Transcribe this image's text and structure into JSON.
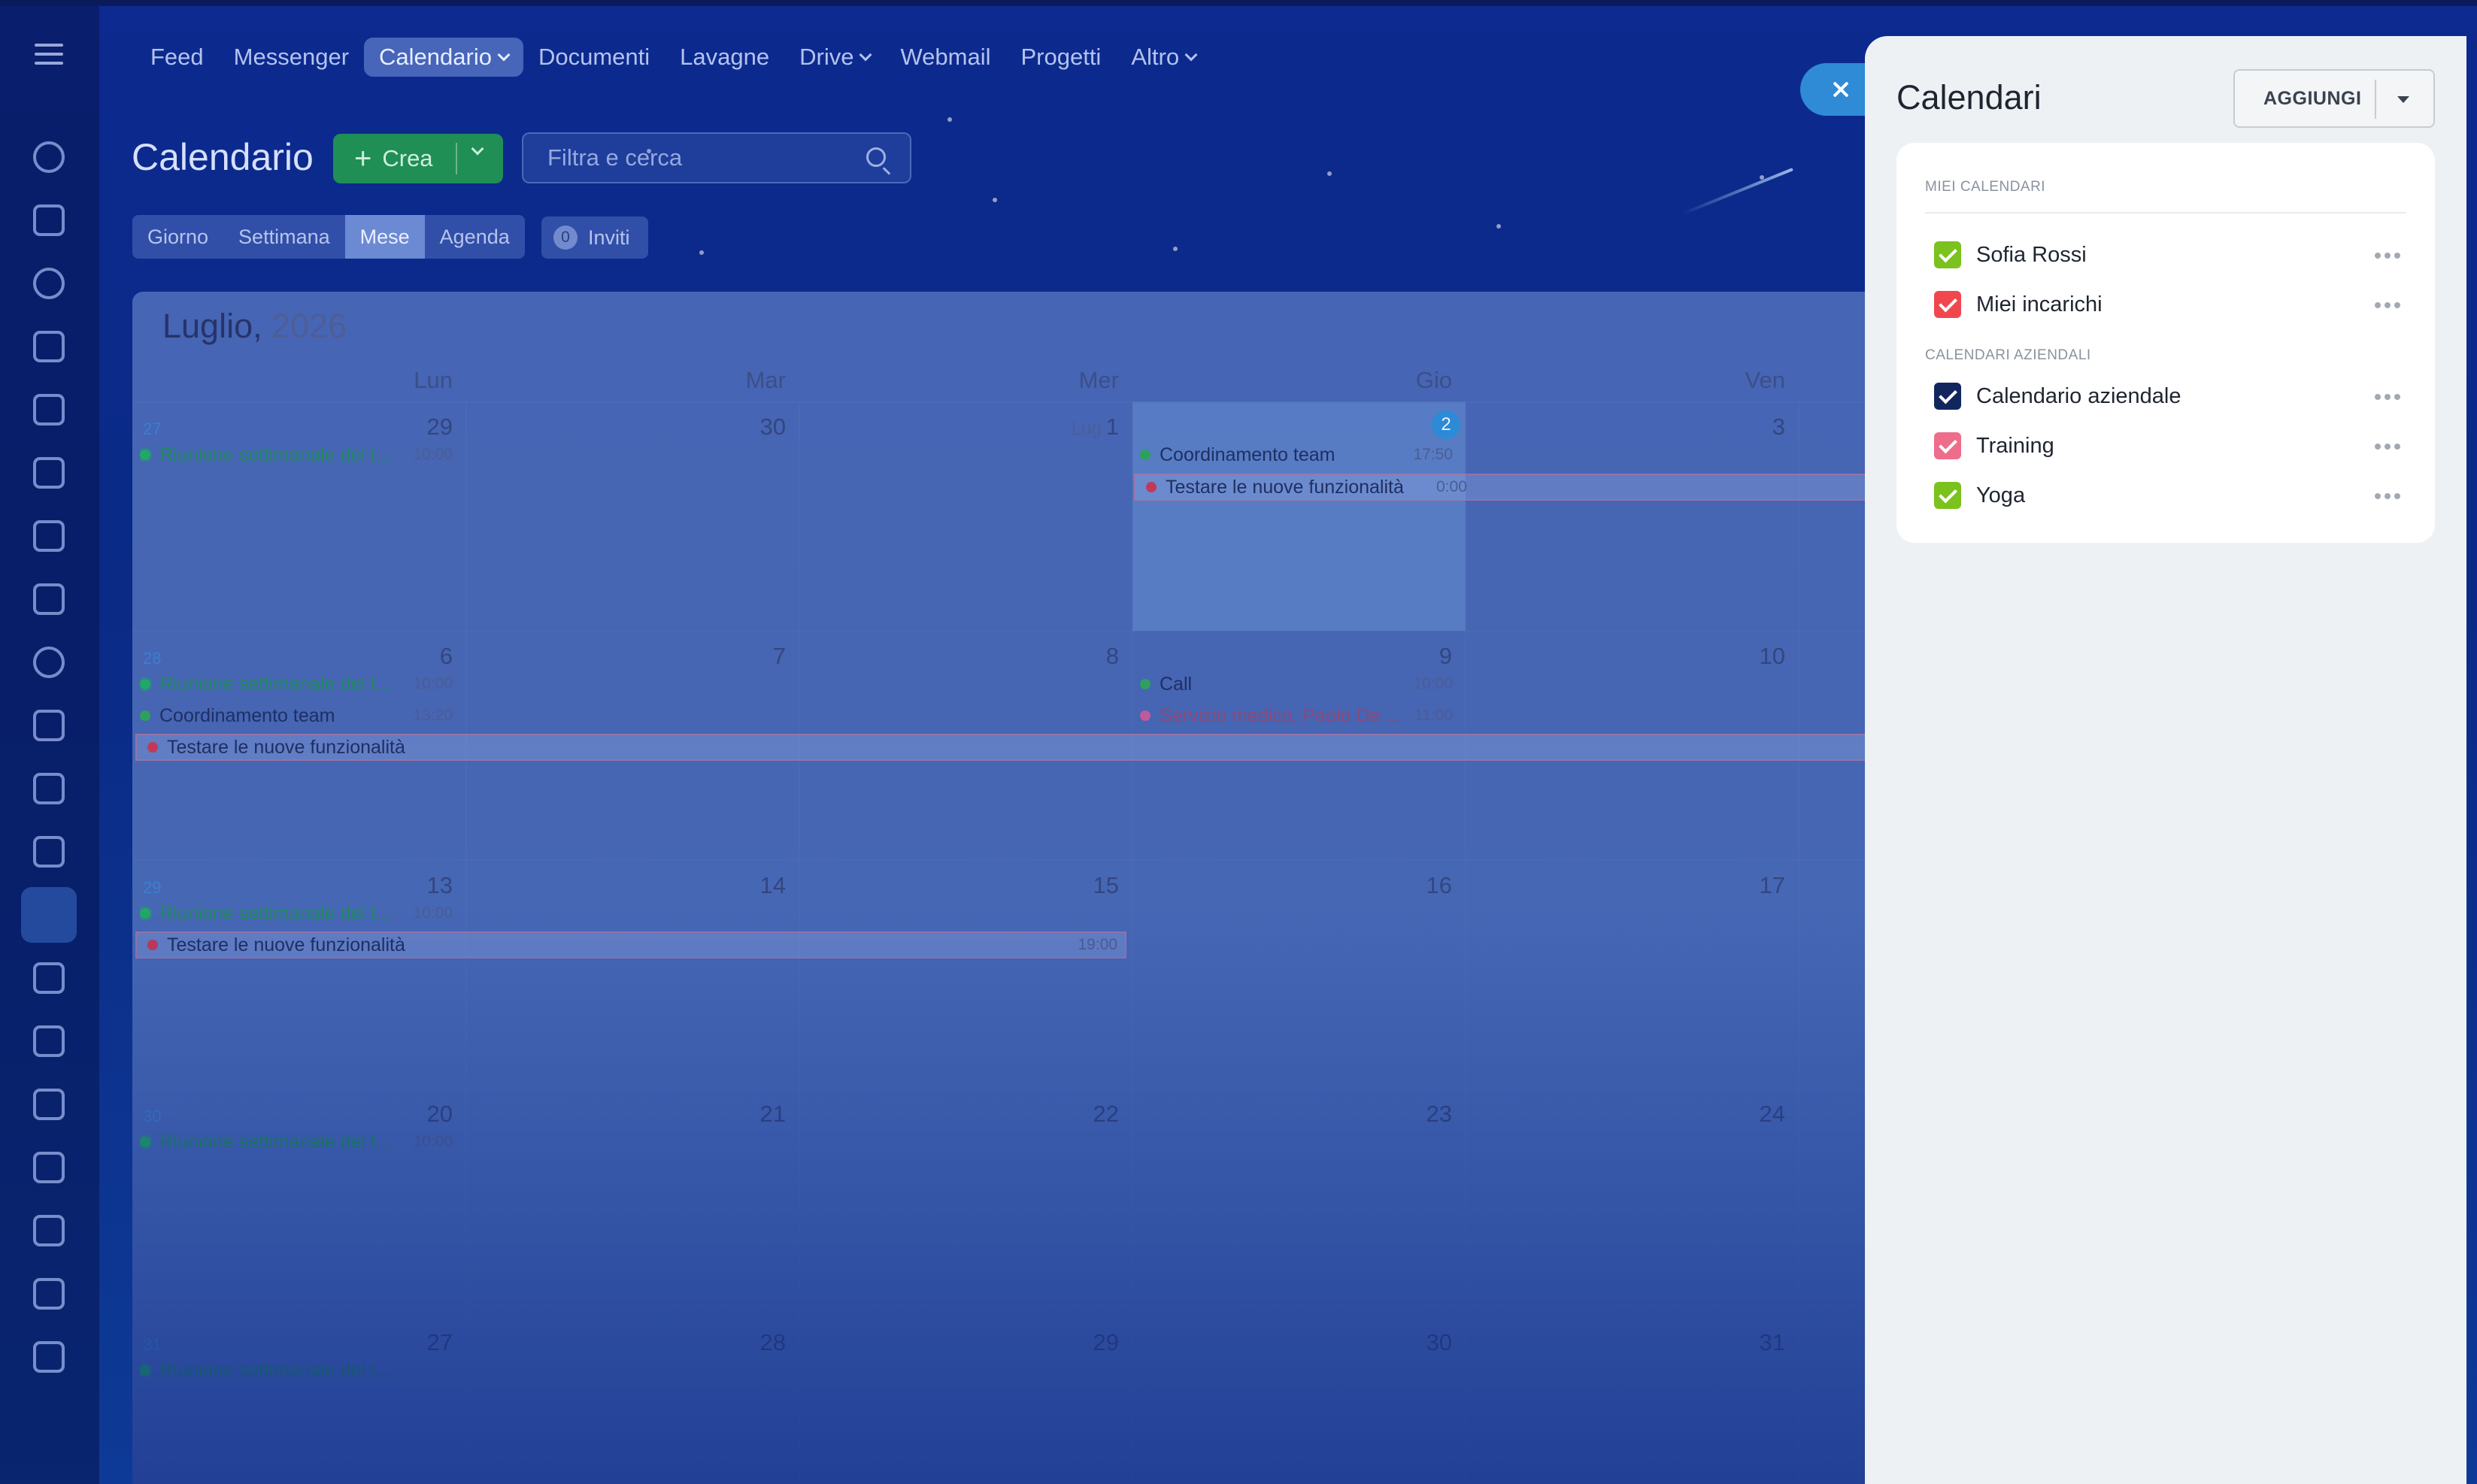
{
  "nav": {
    "items": [
      {
        "label": "Feed",
        "has_menu": false,
        "active": false
      },
      {
        "label": "Messenger",
        "has_menu": false,
        "active": false
      },
      {
        "label": "Calendario",
        "has_menu": true,
        "active": true
      },
      {
        "label": "Documenti",
        "has_menu": false,
        "active": false
      },
      {
        "label": "Lavagne",
        "has_menu": false,
        "active": false
      },
      {
        "label": "Drive",
        "has_menu": true,
        "active": false
      },
      {
        "label": "Webmail",
        "has_menu": false,
        "active": false
      },
      {
        "label": "Progetti",
        "has_menu": false,
        "active": false
      },
      {
        "label": "Altro",
        "has_menu": true,
        "active": false
      }
    ]
  },
  "page": {
    "title": "Calendario",
    "create_label": "Crea",
    "search_placeholder": "Filtra e cerca",
    "views": [
      "Giorno",
      "Settimana",
      "Mese",
      "Agenda"
    ],
    "active_view": "Mese",
    "invites_count": "0",
    "invites_label": "Inviti"
  },
  "calendar": {
    "month": "Luglio,",
    "year": "2026",
    "weekdays": [
      "Lun",
      "Mar",
      "Mer",
      "Gio",
      "Ven"
    ],
    "weeks": [
      {
        "week_no": "27",
        "days": [
          "29",
          "30",
          "1",
          "2",
          "3"
        ],
        "prefix_day3": "Lug"
      },
      {
        "week_no": "28",
        "days": [
          "6",
          "7",
          "8",
          "9",
          "10"
        ]
      },
      {
        "week_no": "29",
        "days": [
          "13",
          "14",
          "15",
          "16",
          "17"
        ]
      },
      {
        "week_no": "30",
        "days": [
          "20",
          "21",
          "22",
          "23",
          "24"
        ]
      },
      {
        "week_no": "31",
        "days": [
          "27",
          "28",
          "29",
          "30",
          "31"
        ]
      }
    ],
    "today_label": "2",
    "events": {
      "w1_mon": {
        "title": "Riunione settimanale del t...",
        "time": "10:00"
      },
      "w1_thu_a": {
        "title": "Coordinamento team",
        "time": "17:50"
      },
      "w1_thu_bar": {
        "title": "Testare le nuove funzionalità",
        "time": "0:00"
      },
      "w2_mon_a": {
        "title": "Riunione settimanale del t...",
        "time": "10:00"
      },
      "w2_mon_b": {
        "title": "Coordinamento team",
        "time": "13:20"
      },
      "w2_bar": {
        "title": "Testare le nuove funzionalità"
      },
      "w2_thu_a": {
        "title": "Call",
        "time": "10:00"
      },
      "w2_thu_b": {
        "title": "Servizio medico, Paolo De ...",
        "time": "11:00"
      },
      "w3_mon": {
        "title": "Riunione settimanale del t...",
        "time": "10:00"
      },
      "w3_bar": {
        "title": "Testare le nuove funzionalità",
        "time": "19:00"
      },
      "w4_mon": {
        "title": "Riunione settimanale del t...",
        "time": "10:00"
      },
      "w5_mon": {
        "title": "Riunione settimanale del t..."
      }
    }
  },
  "panel": {
    "title": "Calendari",
    "add_label": "AGGIUNGI",
    "my_section": "MIEI CALENDARI",
    "company_section": "CALENDARI AZIENDALI",
    "my_calendars": [
      {
        "name": "Sofia Rossi",
        "color": "#7cc21f",
        "checked": true
      },
      {
        "name": "Miei incarichi",
        "color": "#f0474e",
        "checked": true
      }
    ],
    "company_calendars": [
      {
        "name": "Calendario aziendale",
        "color": "#12265e",
        "checked": true
      },
      {
        "name": "Training",
        "color": "#ee6d8a",
        "checked": true
      },
      {
        "name": "Yoga",
        "color": "#7cc21f",
        "checked": true
      }
    ]
  }
}
